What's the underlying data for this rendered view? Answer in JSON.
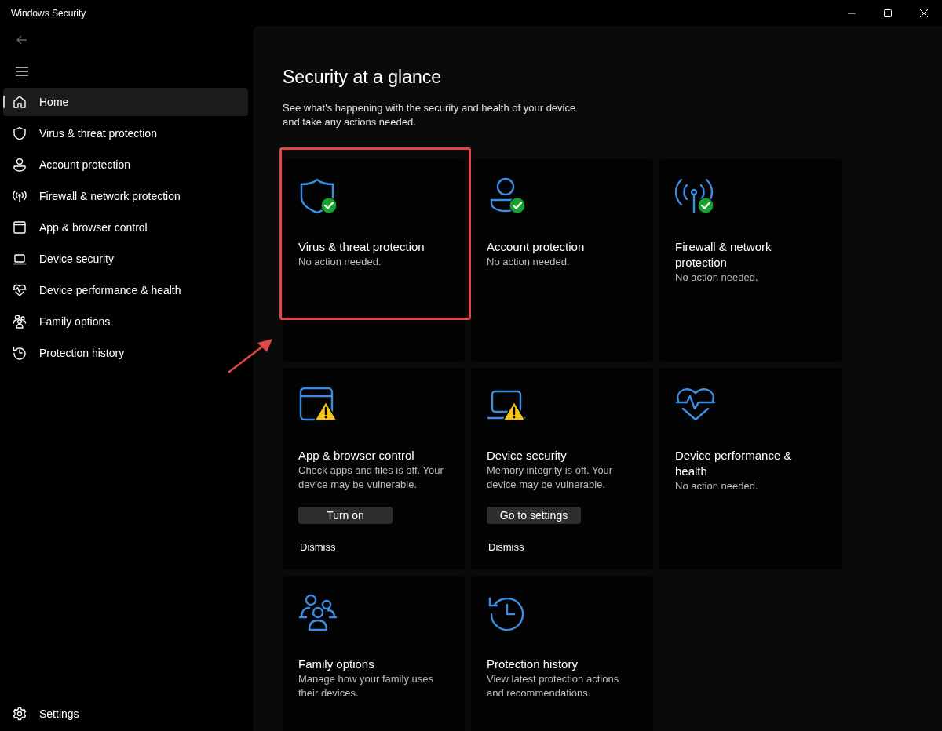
{
  "window": {
    "title": "Windows Security"
  },
  "sidebar": {
    "items": [
      {
        "label": "Home",
        "selected": true
      },
      {
        "label": "Virus & threat protection",
        "selected": false
      },
      {
        "label": "Account protection",
        "selected": false
      },
      {
        "label": "Firewall & network protection",
        "selected": false
      },
      {
        "label": "App & browser control",
        "selected": false
      },
      {
        "label": "Device security",
        "selected": false
      },
      {
        "label": "Device performance & health",
        "selected": false
      },
      {
        "label": "Family options",
        "selected": false
      },
      {
        "label": "Protection history",
        "selected": false
      }
    ],
    "settings": "Settings"
  },
  "main": {
    "heading": "Security at a glance",
    "subtitle": "See what's happening with the security and health of your device and take any actions needed.",
    "cards": [
      {
        "title": "Virus & threat protection",
        "description": "No action needed.",
        "status_ok": true,
        "warning": false,
        "highlighted": true
      },
      {
        "title": "Account protection",
        "description": "No action needed.",
        "status_ok": true,
        "warning": false,
        "highlighted": false
      },
      {
        "title": "Firewall & network protection",
        "description": "No action needed.",
        "status_ok": true,
        "warning": false,
        "highlighted": false
      },
      {
        "title": "App & browser control",
        "description": "Check apps and files is off. Your device may be vulnerable.",
        "status_ok": false,
        "warning": true,
        "highlighted": false,
        "action": "Turn on",
        "dismiss": "Dismiss"
      },
      {
        "title": "Device security",
        "description": "Memory integrity is off. Your device may be vulnerable.",
        "status_ok": false,
        "warning": true,
        "highlighted": false,
        "action": "Go to settings",
        "dismiss": "Dismiss"
      },
      {
        "title": "Device performance & health",
        "description": "No action needed.",
        "status_ok": false,
        "warning": false,
        "highlighted": false
      },
      {
        "title": "Family options",
        "description": "Manage how your family uses their devices.",
        "status_ok": false,
        "warning": false,
        "highlighted": false
      },
      {
        "title": "Protection history",
        "description": "View latest protection actions and recommendations.",
        "status_ok": false,
        "warning": false,
        "highlighted": false
      }
    ]
  }
}
